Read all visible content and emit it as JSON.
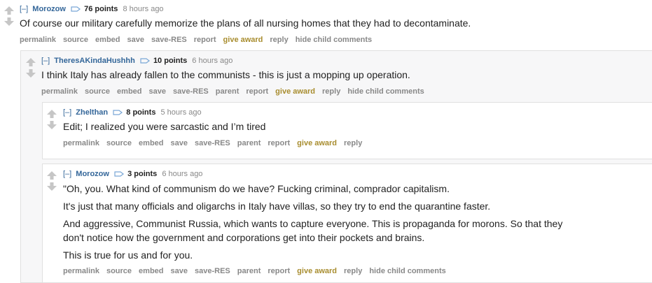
{
  "comments": [
    {
      "toggle": "[–]",
      "author": "Morozow",
      "score": "76 points",
      "time": "8 hours ago",
      "body": [
        "Of course our military carefully memorize the plans of all nursing homes that they had to decontaminate."
      ],
      "buttons": [
        "permalink",
        "source",
        "embed",
        "save",
        "save-RES",
        "report",
        "give award",
        "reply",
        "hide child comments"
      ]
    },
    {
      "toggle": "[–]",
      "author": "TheresAKindaHushhh",
      "score": "10 points",
      "time": "6 hours ago",
      "body": [
        "I think Italy has already fallen to the communists - this is just a mopping up operation."
      ],
      "buttons": [
        "permalink",
        "source",
        "embed",
        "save",
        "save-RES",
        "parent",
        "report",
        "give award",
        "reply",
        "hide child comments"
      ]
    },
    {
      "toggle": "[–]",
      "author": "Zhelthan",
      "score": "8 points",
      "time": "5 hours ago",
      "body": [
        "Edit; I realized you were sarcastic and I’m tired"
      ],
      "buttons": [
        "permalink",
        "source",
        "embed",
        "save",
        "save-RES",
        "parent",
        "report",
        "give award",
        "reply"
      ]
    },
    {
      "toggle": "[–]",
      "author": "Morozow",
      "score": "3 points",
      "time": "6 hours ago",
      "body": [
        "\"Oh, you. What kind of communism do we have? Fucking criminal, comprador capitalism.",
        "It's just that many officials and oligarchs in Italy have villas, so they try to end the quarantine faster.",
        "And aggressive, Communist Russia, which wants to capture everyone. This is propaganda for morons. So that they",
        "don't notice how the government and corporations get into their pockets and brains.",
        "This is true for us and for you."
      ],
      "buttons": [
        "permalink",
        "source",
        "embed",
        "save",
        "save-RES",
        "parent",
        "report",
        "give award",
        "reply",
        "hide child comments"
      ]
    }
  ],
  "colors": {
    "author": "#336699",
    "award": "#a88d2f",
    "meta": "#888888",
    "text": "#222222"
  },
  "icons": {
    "upvote": "up-arrow-icon",
    "downvote": "down-arrow-icon",
    "tag": "tag-icon"
  }
}
